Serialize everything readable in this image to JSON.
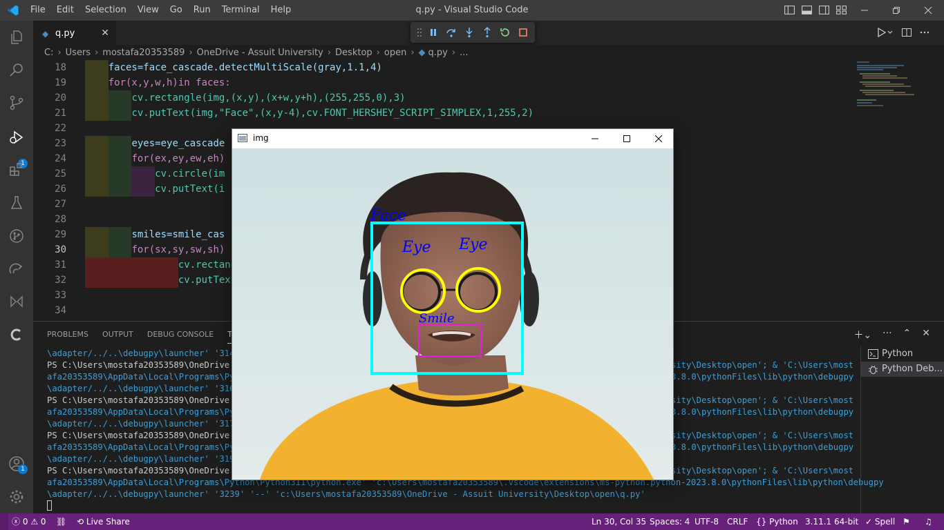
{
  "window": {
    "title": "q.py - Visual Studio Code",
    "menu": [
      "File",
      "Edit",
      "Selection",
      "View",
      "Go",
      "Run",
      "Terminal",
      "Help"
    ]
  },
  "editor": {
    "tab": {
      "label": "q.py",
      "close": "✕"
    },
    "breadcrumb": [
      "C:",
      "Users",
      "mostafa20353589",
      "OneDrive - Assuit University",
      "Desktop",
      "open",
      "q.py",
      "..."
    ],
    "lines": [
      {
        "n": "18",
        "text": "faces=face_cascade.detectMultiScale(gray,1.1,4)"
      },
      {
        "n": "19",
        "text": "for(x,y,w,h)in faces:"
      },
      {
        "n": "20",
        "text": "cv.rectangle(img,(x,y),(x+w,y+h),(255,255,0),3)"
      },
      {
        "n": "21",
        "text": "cv.putText(img,\"Face\",(x,y-4),cv.FONT_HERSHEY_SCRIPT_SIMPLEX,1,255,2)"
      },
      {
        "n": "22",
        "text": ""
      },
      {
        "n": "23",
        "text": "eyes=eye_cascade"
      },
      {
        "n": "24",
        "text": "for(ex,ey,ew,eh)"
      },
      {
        "n": "25",
        "text": "cv.circle(im"
      },
      {
        "n": "26",
        "text": "cv.putText(i"
      },
      {
        "n": "27",
        "text": ""
      },
      {
        "n": "28",
        "text": ""
      },
      {
        "n": "29",
        "text": "smiles=smile_cas"
      },
      {
        "n": "30",
        "text": "for(sx,sy,sw,sh)"
      },
      {
        "n": "31",
        "text": "cv.rectang"
      },
      {
        "n": "32",
        "text": "cv.putText"
      },
      {
        "n": "33",
        "text": ""
      },
      {
        "n": "34",
        "text": ""
      }
    ]
  },
  "panel": {
    "tabs": [
      "PROBLEMS",
      "OUTPUT",
      "DEBUG CONSOLE",
      "TER"
    ],
    "terminal_left": [
      "\\adapter/../..\\debugpy\\launcher' '3146",
      "PS C:\\Users\\mostafa20353589\\OneDrive -",
      "afa20353589\\AppData\\Local\\Programs\\Pyt",
      "\\adapter/../..\\debugpy\\launcher' '3162",
      "PS C:\\Users\\mostafa20353589\\OneDrive -",
      "afa20353589\\AppData\\Local\\Programs\\Pyt",
      "\\adapter/../..\\debugpy\\launcher' '3174",
      "PS C:\\Users\\mostafa20353589\\OneDrive -",
      "afa20353589\\AppData\\Local\\Programs\\Pyt",
      "\\adapter/../..\\debugpy\\launcher' '3191",
      "PS C:\\Users\\mostafa20353589\\OneDrive -"
    ],
    "terminal_right": [
      "",
      "sity\\Desktop\\open'; & 'C:\\Users\\most",
      "3.8.0\\pythonFiles\\lib\\python\\debugpy",
      "",
      "sity\\Desktop\\open'; & 'C:\\Users\\most",
      "3.8.0\\pythonFiles\\lib\\python\\debugpy",
      "",
      "sity\\Desktop\\open'; & 'C:\\Users\\most",
      "3.8.0\\pythonFiles\\lib\\python\\debugpy",
      "",
      "sity\\Desktop\\open'; & 'C:\\Users\\most"
    ],
    "terminal_full": [
      "afa20353589\\AppData\\Local\\Programs\\Python\\Python311\\python.exe' 'c:\\Users\\mostafa20353589\\.vscode\\extensions\\ms-python.python-2023.8.0\\pythonFiles\\lib\\python\\debugpy",
      "\\adapter/../..\\debugpy\\launcher' '3239' '--' 'c:\\Users\\mostafa20353589\\OneDrive - Assuit University\\Desktop\\open\\q.py'"
    ],
    "terminals": [
      "Python",
      "Python Deb..."
    ]
  },
  "cv_window": {
    "title": "img",
    "labels": {
      "face": "Face",
      "eye_left": "Eye",
      "eye_right": "Eye",
      "smile": "Smile"
    }
  },
  "statusbar": {
    "problems": "0",
    "warnings": "0",
    "live_share": "Live Share",
    "position": "Ln 30, Col 35",
    "spaces": "Spaces: 4",
    "encoding": "UTF-8",
    "eol": "CRLF",
    "language": "Python",
    "interpreter": "3.11.1 64-bit",
    "spell": "Spell"
  },
  "badges": {
    "debug": "1",
    "accounts": "1"
  },
  "colors": {
    "accent": "#68217a",
    "face_box": "#00ffff",
    "eye_circle": "#ffff00",
    "smile_box": "#e020e0",
    "label": "#0000ff"
  }
}
